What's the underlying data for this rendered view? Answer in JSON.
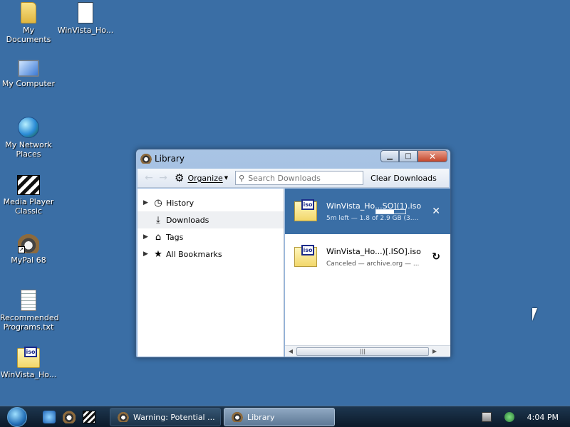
{
  "desktop": {
    "icons": [
      {
        "label": "My Documents",
        "icon": "folder-icon"
      },
      {
        "label": "WinVista_Ho...",
        "icon": "config-file-icon"
      },
      {
        "label": "My Computer",
        "icon": "computer-icon"
      },
      {
        "label": "My Network Places",
        "icon": "network-icon"
      },
      {
        "label": "Media Player Classic",
        "icon": "media-player-icon"
      },
      {
        "label": "MyPal 68",
        "icon": "raccoon-icon"
      },
      {
        "label": "Recommended Programs.txt",
        "icon": "text-file-icon"
      },
      {
        "label": "WinVista_Ho...",
        "icon": "iso-file-icon"
      }
    ]
  },
  "window": {
    "title": "Library",
    "toolbar": {
      "organize_label": "Organize",
      "search_placeholder": "Search Downloads",
      "clear_label": "Clear Downloads"
    },
    "sidebar": {
      "items": [
        {
          "label": "History",
          "icon": "clock-icon",
          "expandable": true
        },
        {
          "label": "Downloads",
          "icon": "download-icon",
          "expandable": false,
          "selected": true
        },
        {
          "label": "Tags",
          "icon": "tag-icon",
          "expandable": true
        },
        {
          "label": "All Bookmarks",
          "icon": "star-icon",
          "expandable": true
        }
      ]
    },
    "downloads": [
      {
        "name": "WinVista_Ho...SO](1).iso",
        "status": "5m left — 1.8 of 2.9 GB (3....",
        "progress": 0.62,
        "action_icon": "cancel-icon",
        "active": true
      },
      {
        "name": "WinVista_Ho...)[.ISO].iso",
        "status": "Canceled — archive.org — ...",
        "action_icon": "retry-icon",
        "active": false
      }
    ],
    "iso_tag": "iso",
    "scroll_grip": "|||"
  },
  "taskbar": {
    "buttons": [
      {
        "label": "Warning: Potential ..."
      },
      {
        "label": "Library",
        "active": true
      }
    ],
    "clock": "4:04 PM"
  },
  "colors": {
    "desktop_bg": "#3a6ea5",
    "selection": "#3a6ea5"
  }
}
